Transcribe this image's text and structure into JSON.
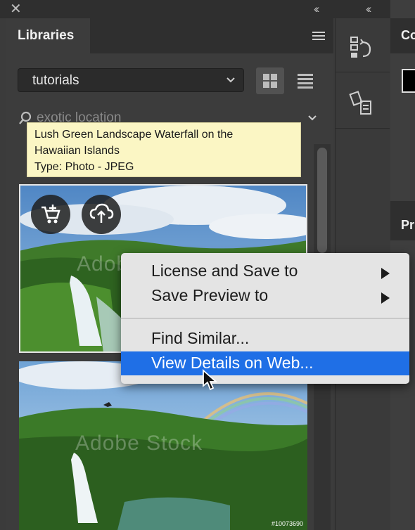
{
  "window": {
    "close_glyph": "✕",
    "collapse_glyph": "‹‹"
  },
  "panel": {
    "title": "Libraries",
    "library_select": {
      "value": "tutorials"
    },
    "search": {
      "value": "exotic location"
    }
  },
  "tooltip": {
    "line1": "Lush Green Landscape Waterfall on the",
    "line2": "Hawaiian Islands",
    "line3": "Type: Photo - JPEG"
  },
  "assets": {
    "watermark": "Adobe Stock",
    "photo2_id": "#10073690"
  },
  "context_menu": {
    "items": [
      {
        "label": "License and Save to"
      },
      {
        "label": "Save Preview to"
      },
      {
        "label": "Find Similar..."
      },
      {
        "label": "View Details on Web..."
      }
    ]
  },
  "right_panels": {
    "top_label": "Co",
    "second_label": "Pr"
  },
  "colors": {
    "highlight": "#1f6fe6",
    "tooltip_bg": "#fbf6c4",
    "panel_bg": "#3c3c3c"
  }
}
